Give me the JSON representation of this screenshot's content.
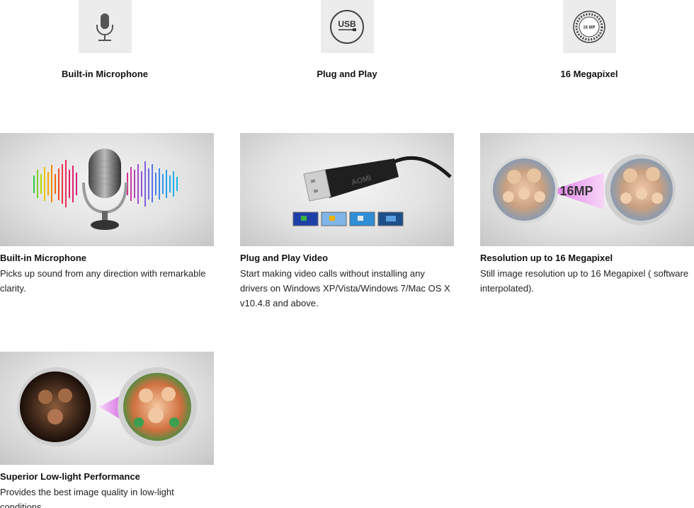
{
  "features": [
    {
      "icon": "microphone-icon",
      "label": "Built-in Microphone"
    },
    {
      "icon": "usb-icon",
      "label": "Plug and Play",
      "icon_text": "USB"
    },
    {
      "icon": "16mp-badge-icon",
      "label": "16 Megapixel",
      "icon_text": "16 MP"
    }
  ],
  "cards": [
    {
      "title": "Built-in Microphone",
      "description": "Picks up sound from any direction with remarkable clarity."
    },
    {
      "title": "Plug and Play Video",
      "description": "Start making video calls without installing any drivers on Windows XP/Vista/Windows 7/Mac OS X v10.4.8 and above.",
      "image_text": "AOMI"
    },
    {
      "title": "Resolution up to 16 Megapixel",
      "description": "Still image resolution up to 16 Megapixel ( software interpolated).",
      "image_text": "16MP"
    },
    {
      "title": "Superior Low-light Performance",
      "description": "Provides the best image quality in low-light conditions."
    }
  ],
  "colors": {
    "icon_tile_bg": "#ececec",
    "card_bg": "#e2e2e2",
    "arrow_magenta": "#e07ae8"
  }
}
